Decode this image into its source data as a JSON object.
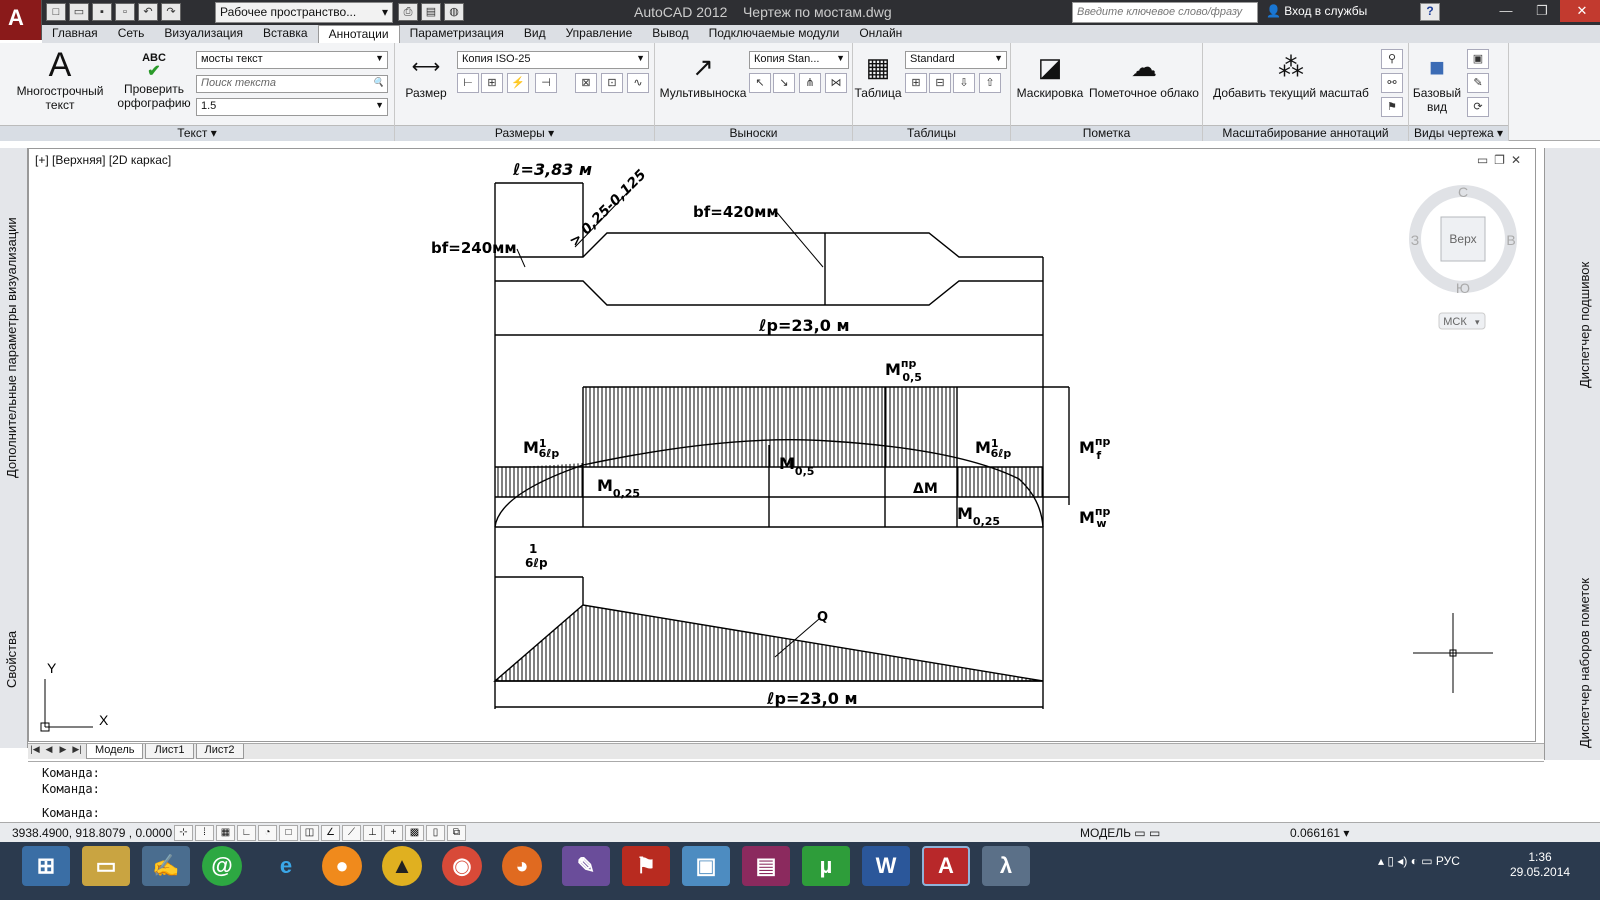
{
  "window": {
    "app_title": "AutoCAD 2012",
    "document_title": "Чертеж по мостам.dwg",
    "workspace": "Рабочее пространство...",
    "search_placeholder": "Введите ключевое слово/фразу",
    "login": "Вход в службы",
    "help": "?"
  },
  "tabs": [
    "Главная",
    "Сеть",
    "Визуализация",
    "Вставка",
    "Аннотации",
    "Параметризация",
    "Вид",
    "Управление",
    "Вывод",
    "Подключаемые модули",
    "Онлайн"
  ],
  "active_tab": "Аннотации",
  "ribbon": {
    "text_panel": {
      "title": "Текст",
      "mtext": "Многострочный текст",
      "spell": "Проверить орфографию",
      "spell_icon_text": "ABC",
      "style": "мосты текст",
      "find_placeholder": "Поиск текста",
      "height": "1.5"
    },
    "dim_panel": {
      "title": "Размеры",
      "dim": "Размер",
      "style": "Копия ISO-25"
    },
    "leader_panel": {
      "title": "Выноски",
      "mleader": "Мультивыноска",
      "style": "Копия Stan..."
    },
    "table_panel": {
      "title": "Таблицы",
      "table": "Таблица",
      "style": "Standard"
    },
    "markup_panel": {
      "title": "Пометка",
      "wipeout": "Маскировка",
      "revcloud": "Пометочное облако"
    },
    "scale_panel": {
      "title": "Масштабирование аннотаций",
      "add_scale": "Добавить текущий масштаб"
    },
    "views_panel": {
      "title": "Виды чертежа",
      "base_view": "Базовый вид"
    }
  },
  "viewport": {
    "label": "[+] [Верхняя] [2D каркас]",
    "viewcube": {
      "n": "С",
      "s": "Ю",
      "w": "З",
      "e": "В",
      "face": "Верх",
      "ucs": "МСК"
    },
    "ucs_x": "X",
    "ucs_y": "Y"
  },
  "drawing": {
    "l_top": "ℓ=3,83 м",
    "slope": "> 0,25-0,125",
    "bf420": "bf=420мм",
    "bf240": "bf=240мм",
    "lp1": "ℓp=23,0 м",
    "m05pr": "M",
    "m05pr_sup": "пр",
    "m05pr_sub": "0,5",
    "m6lp_left": "M",
    "m6lp_sup": "1",
    "m6lp_sub": "6ℓр",
    "mf": "M",
    "mf_sup": "пр",
    "mf_sub": "f",
    "m025a": "M",
    "m025a_sub": "0,25",
    "m05": "M",
    "m05_sub": "0,5",
    "dm": "ΔM",
    "m025b": "M",
    "m025b_sub": "0,25",
    "mw": "M",
    "mw_sup": "пр",
    "mw_sub": "w",
    "frac_top": "1",
    "frac_bottom": "6ℓр",
    "q_label": "Q",
    "lp2": "ℓp=23,0 м"
  },
  "layout_tabs": [
    "Модель",
    "Лист1",
    "Лист2"
  ],
  "command_lines": [
    "Команда:",
    "Команда:",
    "Команда:"
  ],
  "status": {
    "coords": "3938.4900, 918.8079 , 0.0000",
    "model": "МОДЕЛЬ",
    "scale": "0.066161"
  },
  "taskbar": {
    "lang": "РУС",
    "time": "1:36",
    "date": "29.05.2014"
  },
  "colors": {
    "titlebar": "#2e2f33",
    "ribbon": "#f3f4f6",
    "taskbar": "#2b3a4e",
    "app_red": "#8a1a1a"
  }
}
